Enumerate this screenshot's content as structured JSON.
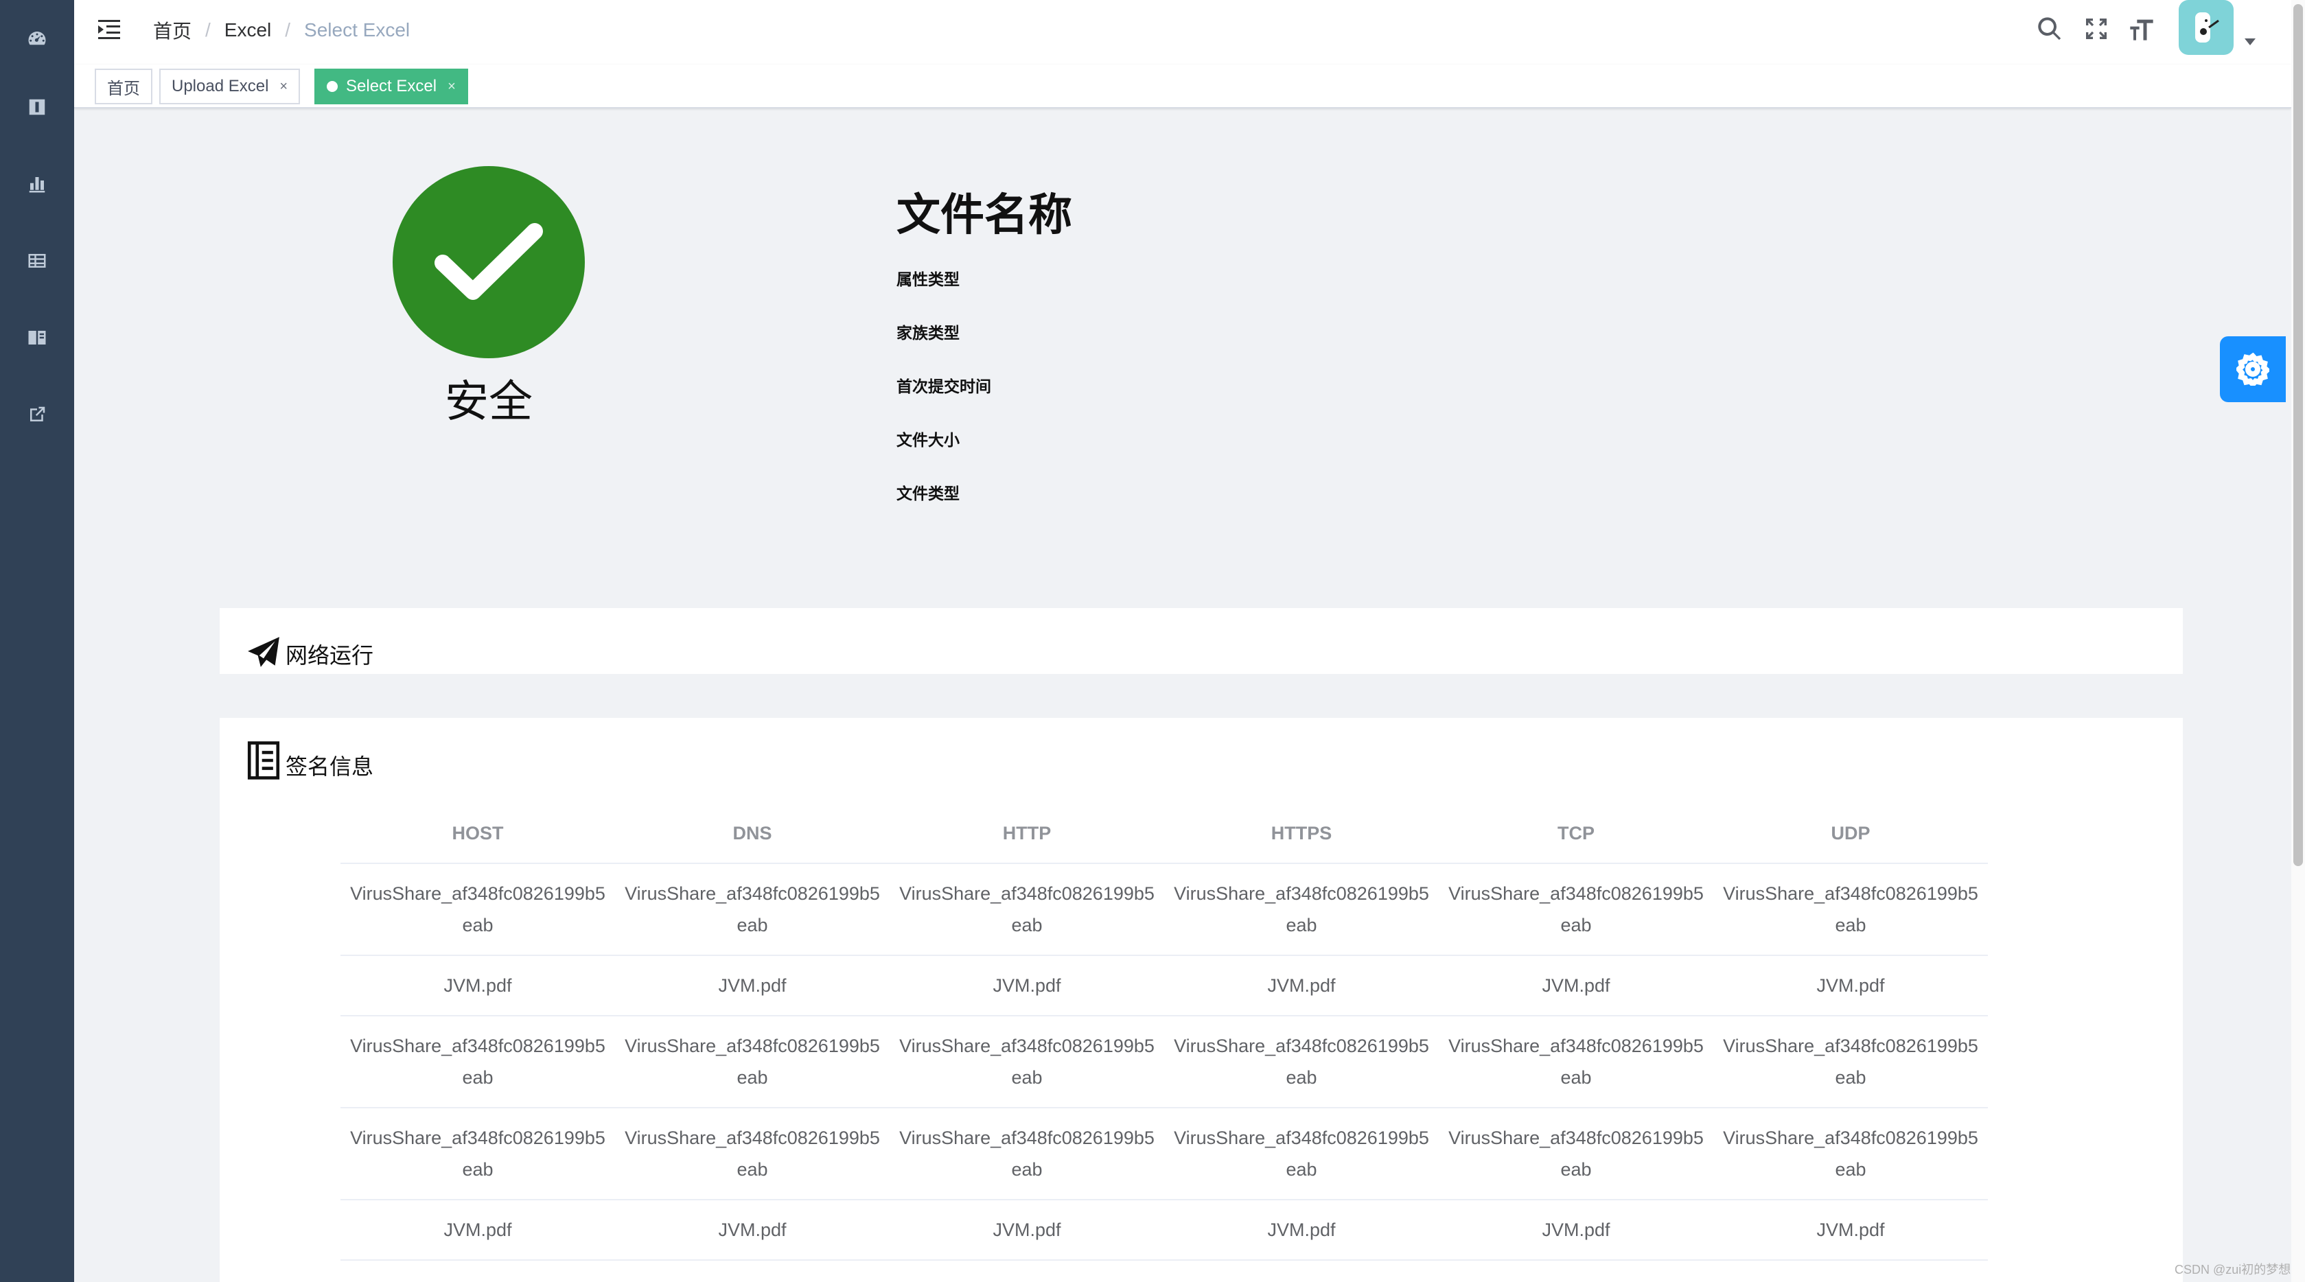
{
  "sidebar": {
    "items": [
      {
        "icon": "dashboard-icon"
      },
      {
        "icon": "document-icon"
      },
      {
        "icon": "chart-icon"
      },
      {
        "icon": "table-icon"
      },
      {
        "icon": "book-icon"
      },
      {
        "icon": "external-link-icon"
      }
    ]
  },
  "breadcrumb": {
    "items": [
      "首页",
      "Excel",
      "Select Excel"
    ],
    "separator": "/"
  },
  "navbar": {
    "icons": [
      "search-icon",
      "fullscreen-icon",
      "font-size-icon"
    ],
    "avatar_color": "#7fd3d8"
  },
  "tags": [
    {
      "label": "首页",
      "active": false,
      "closable": false
    },
    {
      "label": "Upload Excel",
      "active": false,
      "closable": true,
      "close": "×"
    },
    {
      "label": "Select Excel",
      "active": true,
      "closable": true,
      "close": "×"
    }
  ],
  "result": {
    "status": "安全",
    "status_color": "#2e8b24"
  },
  "file_info": {
    "title": "文件名称",
    "fields": [
      "属性类型",
      "家族类型",
      "首次提交时间",
      "文件大小",
      "文件类型"
    ]
  },
  "cards": {
    "network": {
      "title": "网络运行",
      "icon": "paper-plane-icon"
    },
    "signature": {
      "title": "签名信息",
      "icon": "notebook-icon"
    }
  },
  "signature_table": {
    "columns": [
      "HOST",
      "DNS",
      "HTTP",
      "HTTPS",
      "TCP",
      "UDP"
    ],
    "rows": [
      [
        "VirusShare_af348fc0826199b5eab",
        "VirusShare_af348fc0826199b5eab",
        "VirusShare_af348fc0826199b5eab",
        "VirusShare_af348fc0826199b5eab",
        "VirusShare_af348fc0826199b5eab",
        "VirusShare_af348fc0826199b5eab"
      ],
      [
        "JVM.pdf",
        "JVM.pdf",
        "JVM.pdf",
        "JVM.pdf",
        "JVM.pdf",
        "JVM.pdf"
      ],
      [
        "VirusShare_af348fc0826199b5eab",
        "VirusShare_af348fc0826199b5eab",
        "VirusShare_af348fc0826199b5eab",
        "VirusShare_af348fc0826199b5eab",
        "VirusShare_af348fc0826199b5eab",
        "VirusShare_af348fc0826199b5eab"
      ],
      [
        "VirusShare_af348fc0826199b5eab",
        "VirusShare_af348fc0826199b5eab",
        "VirusShare_af348fc0826199b5eab",
        "VirusShare_af348fc0826199b5eab",
        "VirusShare_af348fc0826199b5eab",
        "VirusShare_af348fc0826199b5eab"
      ],
      [
        "JVM.pdf",
        "JVM.pdf",
        "JVM.pdf",
        "JVM.pdf",
        "JVM.pdf",
        "JVM.pdf"
      ]
    ]
  },
  "settings_button": {
    "icon": "gear-icon",
    "color": "#1890ff"
  },
  "watermark": "CSDN @zui初的梦想"
}
